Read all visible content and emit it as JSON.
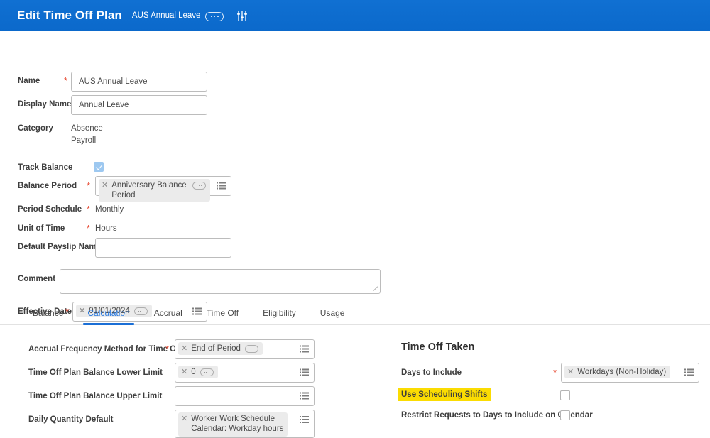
{
  "header": {
    "title": "Edit Time Off Plan",
    "subtitle": "AUS Annual Leave",
    "dots_label": "related-actions",
    "settings_icon": "sliders-icon"
  },
  "form": {
    "name": {
      "label": "Name",
      "value": "AUS Annual Leave",
      "required": true
    },
    "display_name": {
      "label": "Display Name",
      "value": "Annual Leave",
      "required": false
    },
    "category": {
      "label": "Category",
      "values": [
        "Absence",
        "Payroll"
      ]
    },
    "track_balance": {
      "label": "Track Balance",
      "checked": true
    },
    "balance_period": {
      "label": "Balance Period",
      "required": true,
      "chip": "Anniversary Balance Period"
    },
    "period_schedule": {
      "label": "Period Schedule",
      "required": true,
      "value": "Monthly"
    },
    "unit_of_time": {
      "label": "Unit of Time",
      "required": true,
      "value": "Hours"
    },
    "default_payslip_name": {
      "label": "Default Payslip Name",
      "value": "",
      "placeholder": ""
    },
    "comment": {
      "label": "Comment",
      "value": "",
      "placeholder": ""
    },
    "effective_date": {
      "label": "Effective Date",
      "required": true,
      "chip": "01/01/2024"
    }
  },
  "tabs": {
    "items": [
      {
        "label": "Balance",
        "active": false
      },
      {
        "label": "Calculation",
        "active": true
      },
      {
        "label": "Accrual",
        "active": false
      },
      {
        "label": "Time Off",
        "active": false
      },
      {
        "label": "Eligibility",
        "active": false
      },
      {
        "label": "Usage",
        "active": false
      }
    ]
  },
  "calculation": {
    "accrual_frequency": {
      "label": "Accrual Frequency Method for Time Off Plan",
      "required": true,
      "chip": "End of Period"
    },
    "lower_limit": {
      "label": "Time Off Plan Balance Lower Limit",
      "required": false,
      "chip": "0"
    },
    "upper_limit": {
      "label": "Time Off Plan Balance Upper Limit",
      "required": false,
      "chip": ""
    },
    "daily_quantity_default": {
      "label": "Daily Quantity Default",
      "required": false,
      "chip": "Worker Work Schedule\nCalendar: Workday hours"
    }
  },
  "time_off_taken": {
    "title": "Time Off Taken",
    "days_to_include": {
      "label": "Days to Include",
      "required": true,
      "chip": "Workdays (Non-Holiday)"
    },
    "use_scheduling_shifts": {
      "label": "Use Scheduling Shifts",
      "checked": false,
      "highlighted": true
    },
    "restrict_requests": {
      "label": "Restrict Requests to Days to Include on Calendar",
      "checked": false
    }
  },
  "colors": {
    "header_blue": "#0b6bce",
    "accent_blue": "#1b6fd6",
    "tab_active": "#2a7ae0",
    "required_star": "#e8503a",
    "highlight_yellow": "#fbdc02",
    "chip_gray": "#ebebeb",
    "checkbox_checked": "#9dc8f0"
  }
}
